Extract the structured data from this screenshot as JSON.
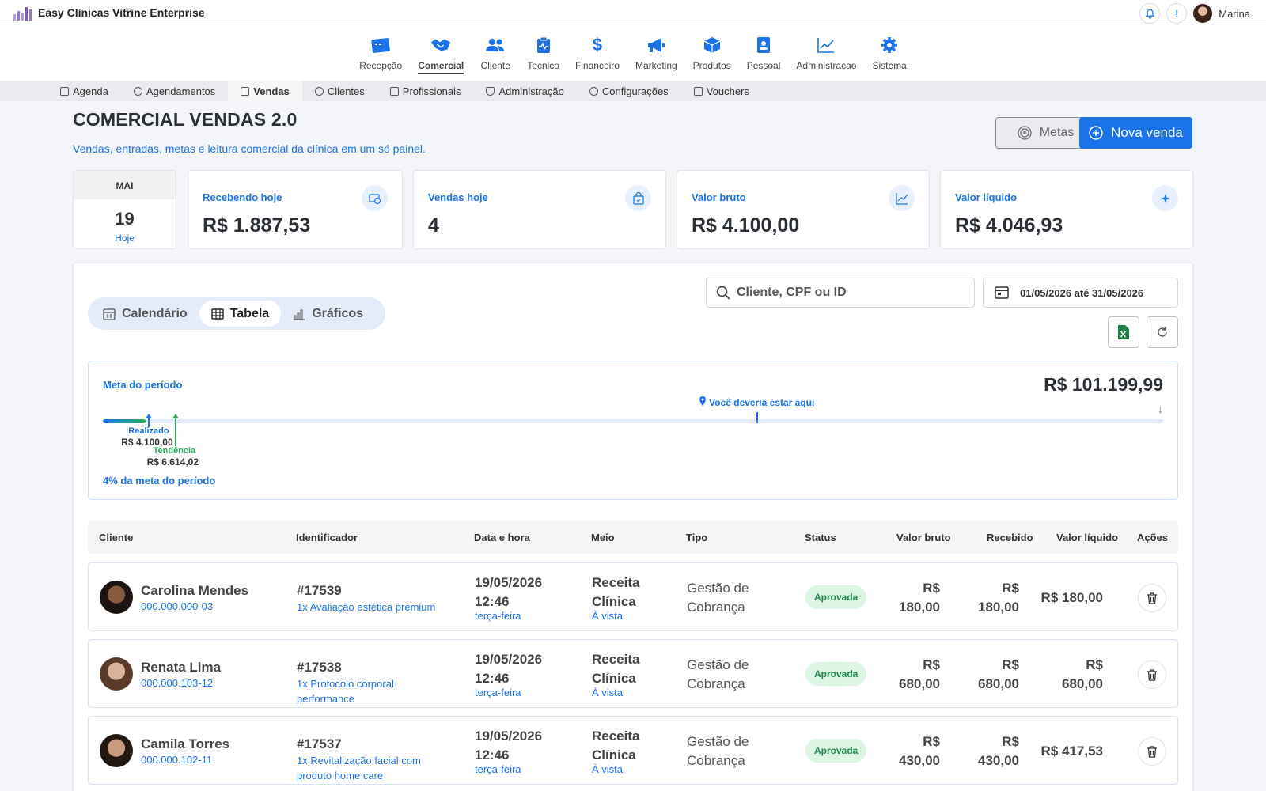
{
  "app": {
    "title": "Easy Clínicas Vitrine Enterprise",
    "user": "Marina",
    "alert_badge": "!"
  },
  "modules": [
    {
      "label": "Recepção",
      "icon": "reception-icon",
      "active": false
    },
    {
      "label": "Comercial",
      "icon": "handshake-icon",
      "active": true
    },
    {
      "label": "Cliente",
      "icon": "users-icon",
      "active": false
    },
    {
      "label": "Tecnico",
      "icon": "clipboard-pulse-icon",
      "active": false
    },
    {
      "label": "Financeiro",
      "icon": "dollar-icon",
      "active": false
    },
    {
      "label": "Marketing",
      "icon": "megaphone-icon",
      "active": false
    },
    {
      "label": "Produtos",
      "icon": "box-icon",
      "active": false
    },
    {
      "label": "Pessoal",
      "icon": "badge-icon",
      "active": false
    },
    {
      "label": "Administracao",
      "icon": "chart-line-icon",
      "active": false
    },
    {
      "label": "Sistema",
      "icon": "gear-icon",
      "active": false
    }
  ],
  "subnav": [
    {
      "label": "Agenda",
      "active": false
    },
    {
      "label": "Agendamentos",
      "active": false
    },
    {
      "label": "Vendas",
      "active": true
    },
    {
      "label": "Clientes",
      "active": false
    },
    {
      "label": "Profissionais",
      "active": false
    },
    {
      "label": "Administração",
      "active": false
    },
    {
      "label": "Configurações",
      "active": false
    },
    {
      "label": "Vouchers",
      "active": false
    }
  ],
  "header": {
    "title": "COMERCIAL VENDAS 2.0",
    "subtitle": "Vendas, entradas, metas e leitura comercial da clínica em um só painel.",
    "metas_label": "Metas",
    "nova_venda_label": "Nova venda"
  },
  "date_card": {
    "month": "MAI",
    "day": "19",
    "today": "Hoje"
  },
  "kpis": [
    {
      "label": "Recebendo hoje",
      "value": "R$ 1.887,53",
      "icon": "coins-icon"
    },
    {
      "label": "Vendas hoje",
      "value": "4",
      "icon": "shopping-bag-icon"
    },
    {
      "label": "Valor bruto",
      "value": "R$ 4.100,00",
      "icon": "trend-up-icon"
    },
    {
      "label": "Valor líquido",
      "value": "R$ 4.046,93",
      "icon": "sparkles-icon"
    }
  ],
  "views": {
    "calendar": "Calendário",
    "table": "Tabela",
    "charts": "Gráficos",
    "active": "table"
  },
  "search": {
    "placeholder": "Cliente, CPF ou ID"
  },
  "date_range": "01/05/2026 até 31/05/2026",
  "goal": {
    "label": "Meta do período",
    "total": "R$ 101.199,99",
    "marker_label": "Você deveria estar aqui",
    "marker_fraction": 0.617,
    "realized_label": "Realizado",
    "realized_value": "R$ 4.100,00",
    "realized_fraction": 0.0405,
    "trend_label": "Tendência",
    "trend_value": "R$ 6.614,02",
    "trend_fraction": 0.0654,
    "percent_text": "4% da meta do período"
  },
  "table": {
    "headers": {
      "cliente": "Cliente",
      "identificador": "Identificador",
      "data": "Data e hora",
      "meio": "Meio",
      "tipo": "Tipo",
      "status": "Status",
      "bruto": "Valor bruto",
      "recebido": "Recebido",
      "liquido": "Valor líquido",
      "acoes": "Ações"
    },
    "rows": [
      {
        "name": "Carolina Mendes",
        "cpf": "000.000.000-03",
        "id": "#17539",
        "item": "1x Avaliação estética premium",
        "date": "19/05/2026",
        "time": "12:46",
        "weekday": "terça-feira",
        "meio1": "Receita",
        "meio2": "Clínica",
        "meio_sub": "À vista",
        "tipo1": "Gestão de",
        "tipo2": "Cobrança",
        "status": "Aprovada",
        "bruto1": "R$",
        "bruto2": "180,00",
        "recebido1": "R$",
        "recebido2": "180,00",
        "liquido1": "R$ 180,00",
        "liquido2": ""
      },
      {
        "name": "Renata Lima",
        "cpf": "000.000.103-12",
        "id": "#17538",
        "item": "1x Protocolo corporal performance",
        "date": "19/05/2026",
        "time": "12:46",
        "weekday": "terça-feira",
        "meio1": "Receita",
        "meio2": "Clínica",
        "meio_sub": "À vista",
        "tipo1": "Gestão de",
        "tipo2": "Cobrança",
        "status": "Aprovada",
        "bruto1": "R$",
        "bruto2": "680,00",
        "recebido1": "R$",
        "recebido2": "680,00",
        "liquido1": "R$",
        "liquido2": "680,00"
      },
      {
        "name": "Camila Torres",
        "cpf": "000.000.102-11",
        "id": "#17537",
        "item": "1x Revitalização facial com produto home care",
        "date": "19/05/2026",
        "time": "12:46",
        "weekday": "terça-feira",
        "meio1": "Receita",
        "meio2": "Clínica",
        "meio_sub": "À vista",
        "tipo1": "Gestão de",
        "tipo2": "Cobrança",
        "status": "Aprovada",
        "bruto1": "R$",
        "bruto2": "430,00",
        "recebido1": "R$",
        "recebido2": "430,00",
        "liquido1": "R$ 417,53",
        "liquido2": ""
      }
    ]
  }
}
